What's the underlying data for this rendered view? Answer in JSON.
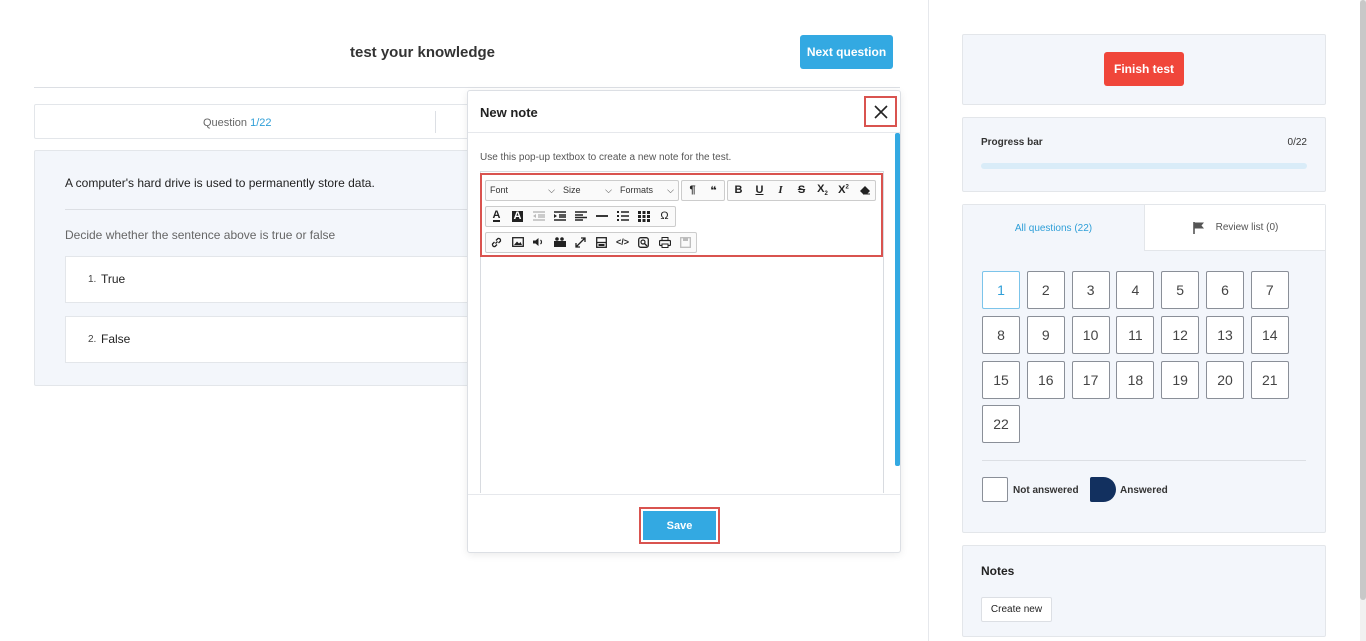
{
  "header": {
    "title": "test your knowledge",
    "next_label": "Next question"
  },
  "qnav": {
    "prefix": "Question",
    "current": "1/22"
  },
  "question": {
    "text": "A computer's hard drive is used to permanently store data.",
    "instruction": "Decide whether the sentence above is true or false",
    "options": [
      {
        "num": "1.",
        "label": "True"
      },
      {
        "num": "2.",
        "label": "False"
      }
    ]
  },
  "modal": {
    "title": "New note",
    "help": "Use this pop-up textbox to create a new note for the test.",
    "toolbar": {
      "font": "Font",
      "size": "Size",
      "formats": "Formats"
    },
    "save_label": "Save"
  },
  "sidebar": {
    "finish_label": "Finish test",
    "progress": {
      "label": "Progress bar",
      "count": "0/22",
      "fraction": 0
    },
    "tabs": {
      "all": "All questions (22)",
      "review": "Review list (0)"
    },
    "questions": [
      "1",
      "2",
      "3",
      "4",
      "5",
      "6",
      "7",
      "8",
      "9",
      "10",
      "11",
      "12",
      "13",
      "14",
      "15",
      "16",
      "17",
      "18",
      "19",
      "20",
      "21",
      "22"
    ],
    "legend": {
      "not_answered": "Not answered",
      "answered": "Answered"
    },
    "notes": {
      "title": "Notes",
      "create_label": "Create new"
    }
  },
  "colors": {
    "accent": "#33a9e2",
    "danger": "#f0463a",
    "answered": "#12305f",
    "highlight": "#d9534f"
  }
}
